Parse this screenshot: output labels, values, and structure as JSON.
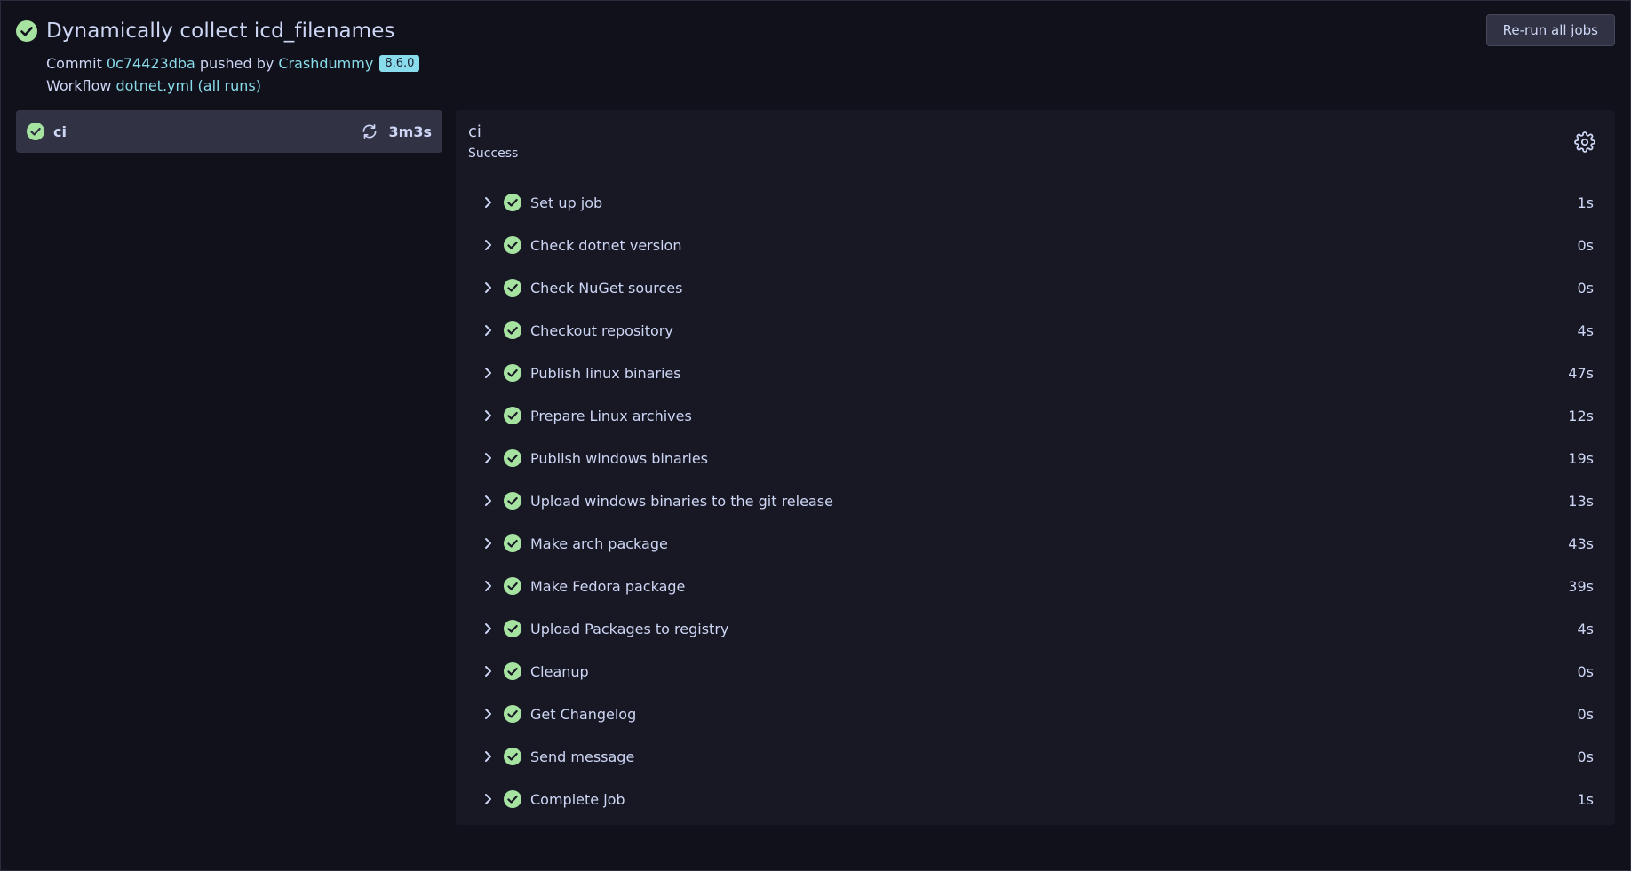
{
  "run": {
    "title": "Dynamically collect icd_filenames",
    "commit_label": "Commit",
    "commit_sha": "0c74423dba",
    "pushed_by_label": "pushed by",
    "author": "Crashdummy",
    "tag": "8.6.0",
    "workflow_label": "Workflow",
    "workflow_file": "dotnet.yml",
    "all_runs_label": "(all runs)",
    "rerun_label": "Re-run all jobs"
  },
  "jobs": [
    {
      "name": "ci",
      "duration": "3m3s",
      "status_icon": "check-circle-icon",
      "action_icon": "refresh-icon"
    }
  ],
  "detail": {
    "name": "ci",
    "status": "Success",
    "settings_icon": "gear-icon",
    "steps": [
      {
        "name": "Set up job",
        "duration": "1s"
      },
      {
        "name": "Check dotnet version",
        "duration": "0s"
      },
      {
        "name": "Check NuGet sources",
        "duration": "0s"
      },
      {
        "name": "Checkout repository",
        "duration": "4s"
      },
      {
        "name": "Publish linux binaries",
        "duration": "47s"
      },
      {
        "name": "Prepare Linux archives",
        "duration": "12s"
      },
      {
        "name": "Publish windows binaries",
        "duration": "19s"
      },
      {
        "name": "Upload windows binaries to the git release",
        "duration": "13s"
      },
      {
        "name": "Make arch package",
        "duration": "43s"
      },
      {
        "name": "Make Fedora package",
        "duration": "39s"
      },
      {
        "name": "Upload Packages to registry",
        "duration": "4s"
      },
      {
        "name": "Cleanup",
        "duration": "0s"
      },
      {
        "name": "Get Changelog",
        "duration": "0s"
      },
      {
        "name": "Send message",
        "duration": "0s"
      },
      {
        "name": "Complete job",
        "duration": "1s"
      }
    ]
  },
  "colors": {
    "background": "#11111b",
    "panel": "#181825",
    "job_item": "#313244",
    "success": "#a6e3a1",
    "link": "#89dceb",
    "text": "#cdd6f4"
  }
}
